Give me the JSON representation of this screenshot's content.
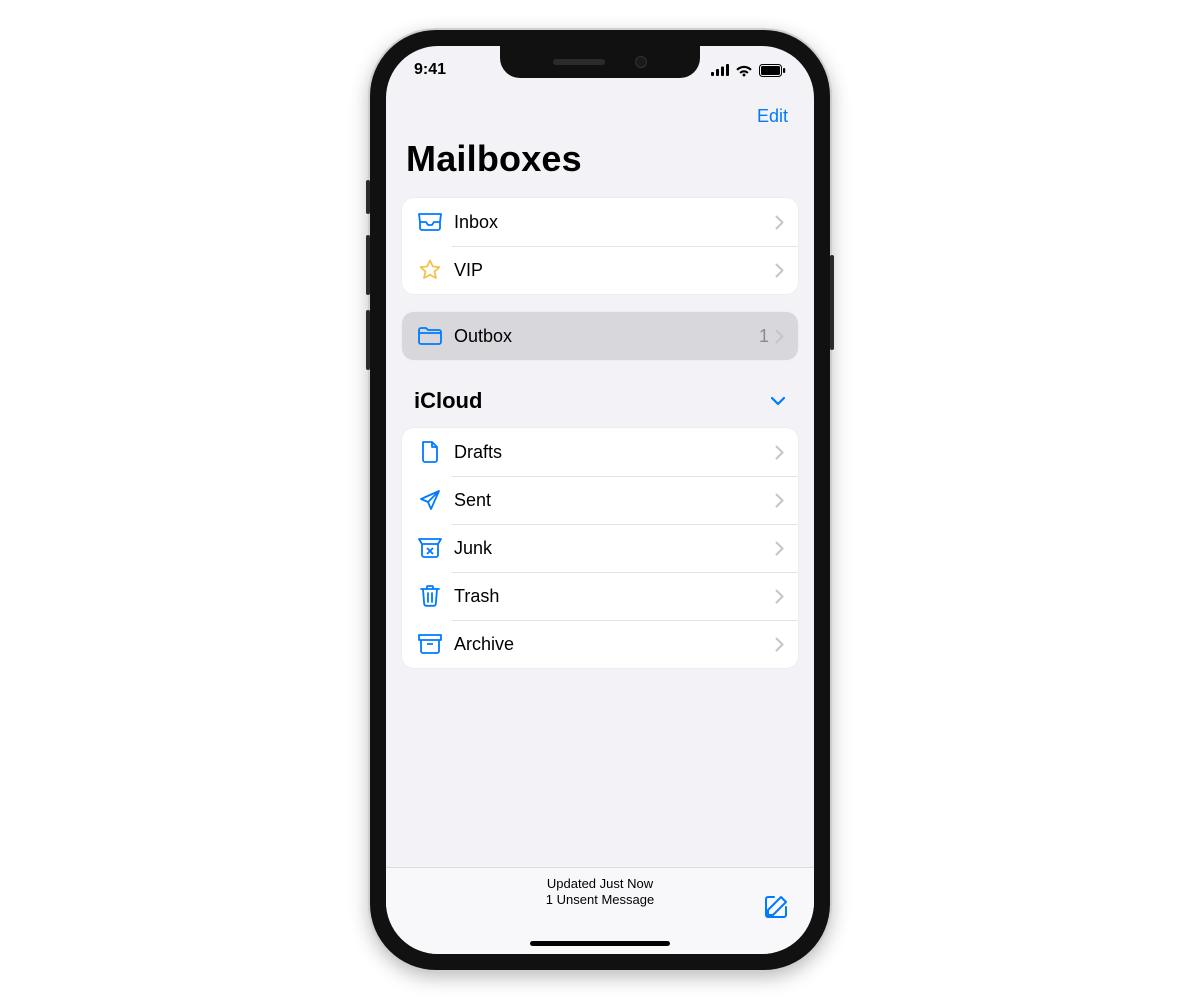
{
  "status_bar": {
    "time": "9:41"
  },
  "nav": {
    "edit_label": "Edit"
  },
  "page_title": "Mailboxes",
  "groups": {
    "main": {
      "items": [
        {
          "label": "Inbox"
        },
        {
          "label": "VIP"
        }
      ]
    },
    "outbox": {
      "label": "Outbox",
      "count": "1"
    }
  },
  "accounts": {
    "icloud": {
      "header": "iCloud",
      "items": [
        {
          "label": "Drafts"
        },
        {
          "label": "Sent"
        },
        {
          "label": "Junk"
        },
        {
          "label": "Trash"
        },
        {
          "label": "Archive"
        }
      ]
    }
  },
  "toolbar": {
    "status_line1": "Updated Just Now",
    "status_line2": "1 Unsent Message"
  },
  "colors": {
    "accent": "#007aff",
    "star": "#f5c24d"
  }
}
